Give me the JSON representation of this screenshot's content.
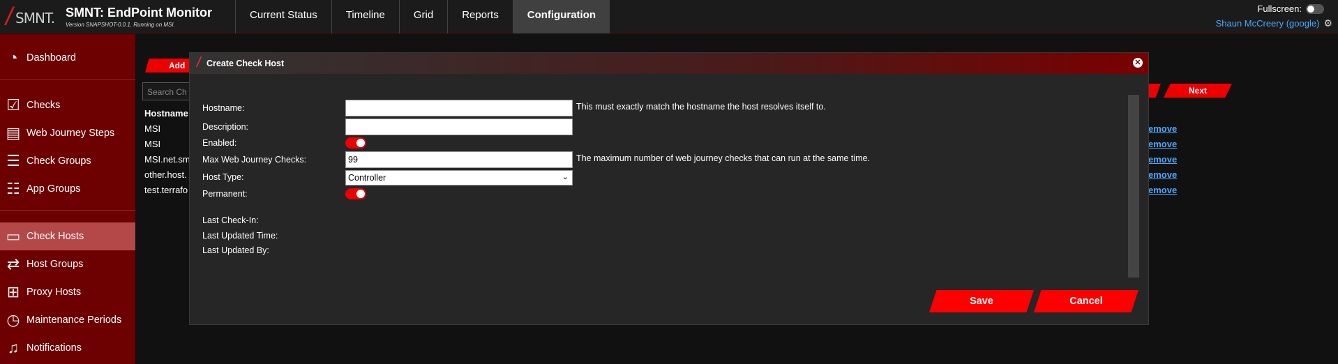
{
  "app": {
    "logo_text": "SMNT.",
    "title": "SMNT: EndPoint Monitor",
    "version": "Version SNAPSHOT-0.0.1. Running on MSI."
  },
  "nav": {
    "tabs": [
      {
        "label": "Current Status"
      },
      {
        "label": "Timeline"
      },
      {
        "label": "Grid"
      },
      {
        "label": "Reports"
      },
      {
        "label": "Configuration",
        "active": true
      }
    ]
  },
  "header_right": {
    "fullscreen_label": "Fullscreen:",
    "fullscreen_on": false,
    "user": "Shaun McCreery (google)",
    "settings_icon": "gear-icon"
  },
  "sidebar": {
    "items": [
      {
        "label": "Dashboard",
        "icon": "gauge-icon"
      },
      {
        "label": "Checks",
        "icon": "checkbox-icon"
      },
      {
        "label": "Web Journey Steps",
        "icon": "browser-icon"
      },
      {
        "label": "Check Groups",
        "icon": "checklist-icon"
      },
      {
        "label": "App Groups",
        "icon": "list-icon"
      },
      {
        "label": "Check Hosts",
        "icon": "monitor-icon",
        "active": true
      },
      {
        "label": "Host Groups",
        "icon": "host-group-icon"
      },
      {
        "label": "Proxy Hosts",
        "icon": "network-icon"
      },
      {
        "label": "Maintenance Periods",
        "icon": "clock-icon"
      },
      {
        "label": "Notifications",
        "icon": "bell-icon"
      }
    ]
  },
  "background": {
    "add_label": "Add",
    "search_placeholder": "Search Ch",
    "table_header": "Hostname",
    "rows": [
      "MSI",
      "MSI",
      "MSI.net.sm",
      "other.host.",
      "test.terrafo"
    ],
    "remove_label": "emove",
    "next_label": "Next"
  },
  "modal": {
    "title": "Create Check Host",
    "hostname_label": "Hostname:",
    "hostname_value": "",
    "hostname_hint": "This must exactly match the hostname the host resolves itself to.",
    "description_label": "Description:",
    "description_value": "",
    "enabled_label": "Enabled:",
    "enabled_on": true,
    "max_checks_label": "Max Web Journey Checks:",
    "max_checks_value": "99",
    "max_checks_hint": "The maximum number of web journey checks that can run at the same time.",
    "host_type_label": "Host Type:",
    "host_type_value": "Controller",
    "permanent_label": "Permanent:",
    "permanent_on": true,
    "last_checkin_label": "Last Check-In:",
    "last_updated_time_label": "Last Updated Time:",
    "last_updated_by_label": "Last Updated By:",
    "save_label": "Save",
    "cancel_label": "Cancel"
  },
  "colors": {
    "accent": "#ff0000",
    "sidebar_bg": "#6d0000",
    "sidebar_active": "#b44848",
    "link": "#4aa8ff"
  }
}
